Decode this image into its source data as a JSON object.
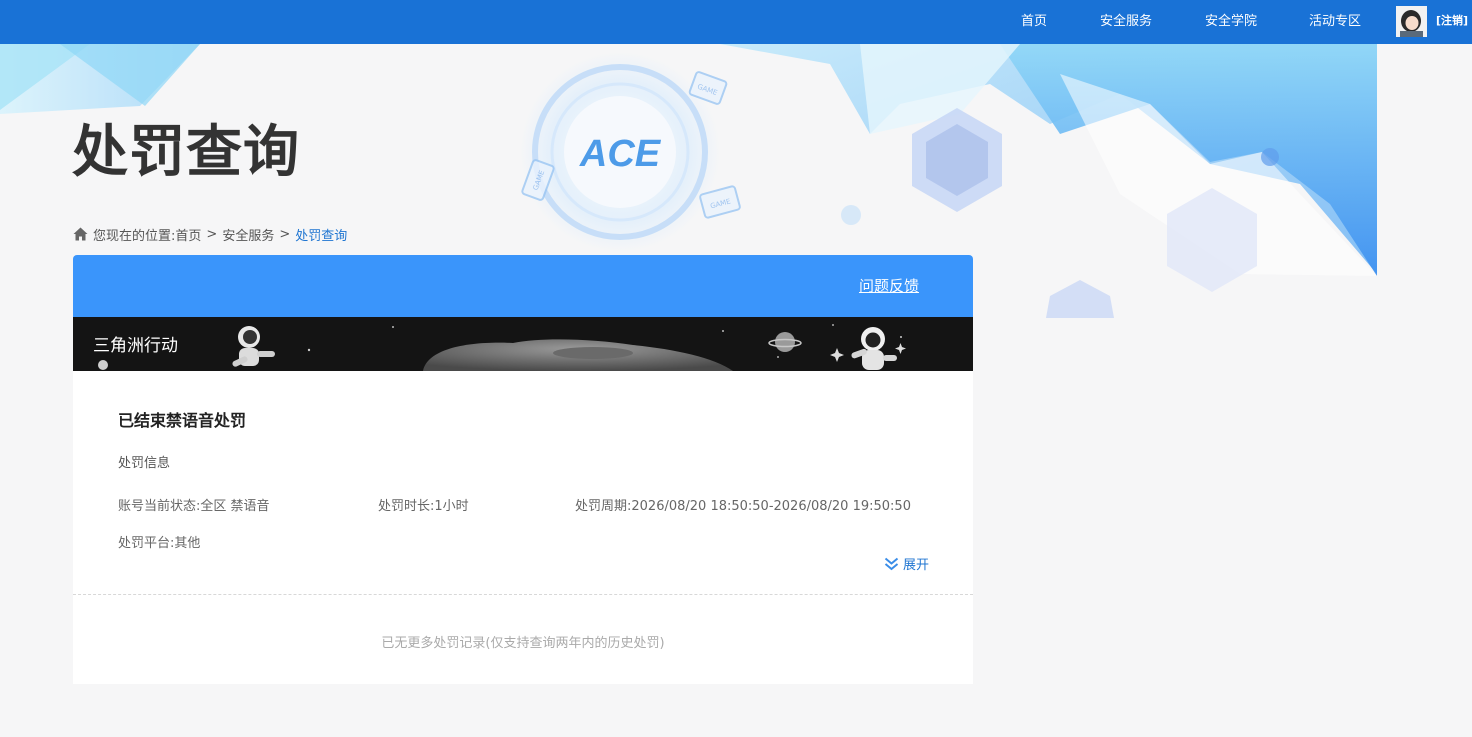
{
  "colors": {
    "nav_bg": "#1972d6",
    "card_header_bg": "#3a95fb",
    "link_blue": "#1f75d1",
    "page_bg": "#f6f6f7"
  },
  "nav": {
    "items": [
      "首页",
      "安全服务",
      "安全学院",
      "活动专区"
    ],
    "logout_label": "[注销]"
  },
  "page": {
    "title": "处罚查询"
  },
  "breadcrumb": {
    "prefix": "您现在的位置:",
    "items": [
      "首页",
      "安全服务"
    ],
    "separator": ">",
    "current": "处罚查询"
  },
  "card": {
    "feedback_label": "问题反馈",
    "game_name": "三角洲行动",
    "record": {
      "title": "已结束禁语音处罚",
      "section_label": "处罚信息",
      "status": "账号当前状态:全区 禁语音",
      "duration": "处罚时长:1小时",
      "period": "处罚周期:2026/08/20 18:50:50-2026/08/20 19:50:50",
      "platform": "处罚平台:其他",
      "expand_label": "展开"
    },
    "no_more_text": "已无更多处罚记录(仅支持查询两年内的历史处罚)"
  }
}
